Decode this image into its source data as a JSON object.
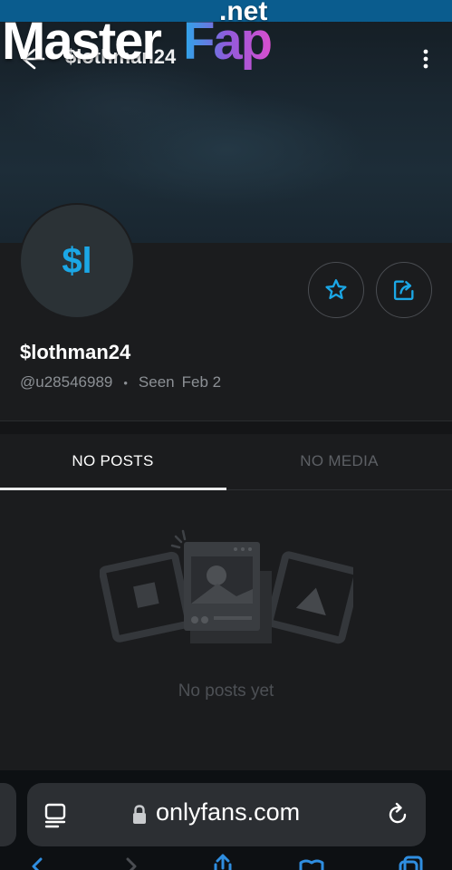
{
  "watermark": {
    "master": "Master",
    "fap": "Fap",
    "net": ".net"
  },
  "header": {
    "title": "$lothman24"
  },
  "profile": {
    "avatar_initials": "$l",
    "display_name": "$lothman24",
    "username": "@u28546989",
    "separator": "•",
    "seen_label": "Seen",
    "seen_date": "Feb 2"
  },
  "tabs": [
    {
      "label": "NO POSTS",
      "active": true
    },
    {
      "label": "NO MEDIA",
      "active": false
    }
  ],
  "empty_state": {
    "message": "No posts yet"
  },
  "browser": {
    "url": "onlyfans.com"
  },
  "colors": {
    "accent": "#1ba7e6",
    "background": "#1b1c1e",
    "status_bar": "#0a5c8e"
  }
}
